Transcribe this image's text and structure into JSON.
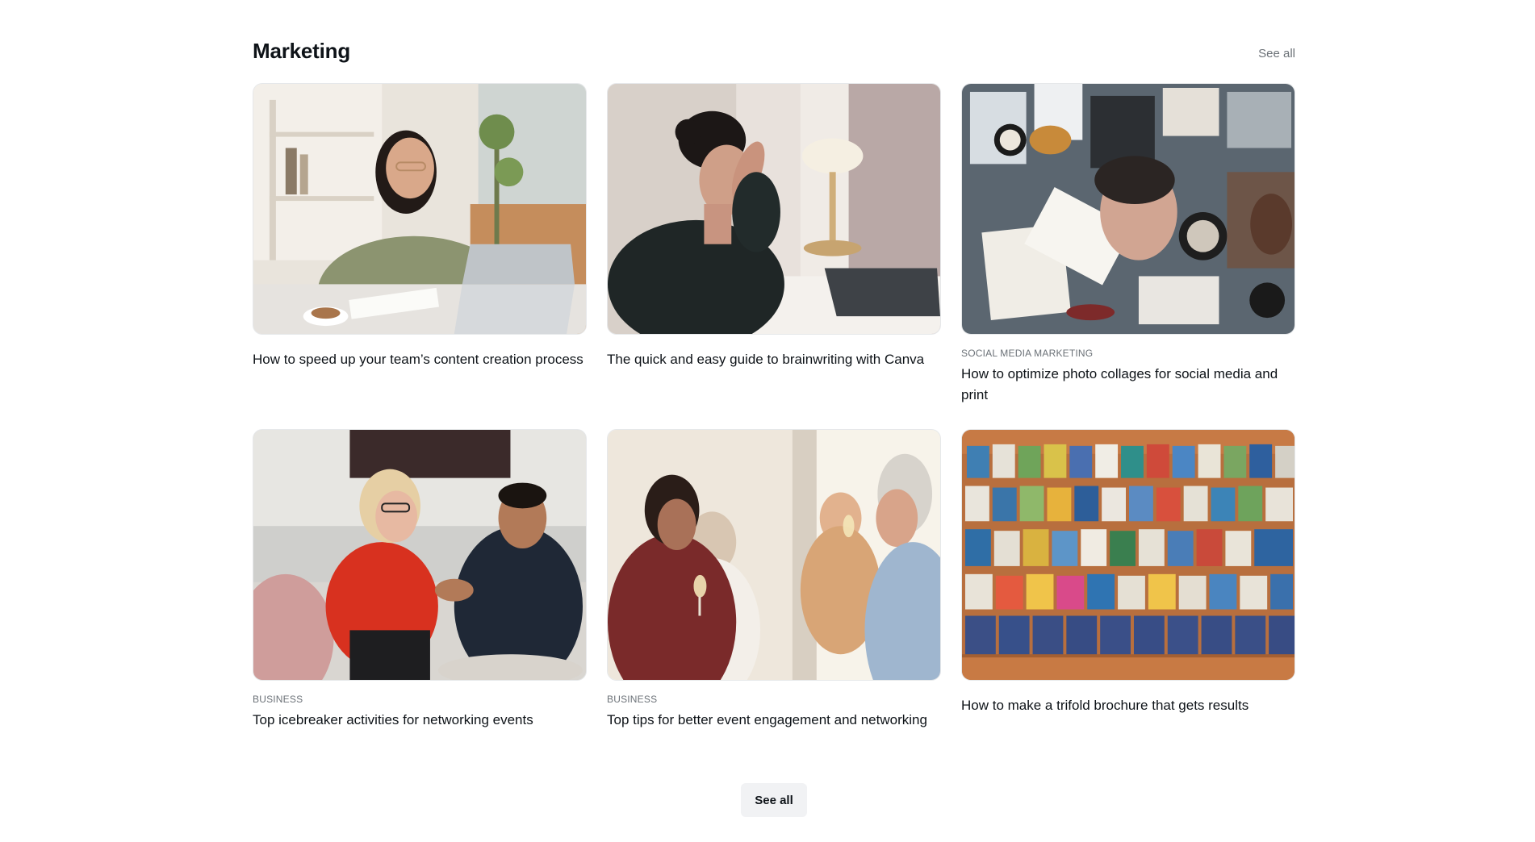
{
  "section": {
    "title": "Marketing",
    "see_all_label": "See all"
  },
  "cards": [
    {
      "category": "",
      "title": "How to speed up your team’s content creation process",
      "image": "woman-with-laptop-illustration"
    },
    {
      "category": "",
      "title": "The quick and easy guide to brainwriting with Canva",
      "image": "woman-thinking-at-desk-illustration"
    },
    {
      "category": "SOCIAL MEDIA MARKETING",
      "title": "How to optimize photo collages for social media and print",
      "image": "photo-collage-illustration"
    },
    {
      "category": "BUSINESS",
      "title": "Top icebreaker activities for networking events",
      "image": "people-talking-illustration"
    },
    {
      "category": "BUSINESS",
      "title": "Top tips for better event engagement and networking",
      "image": "event-networking-illustration"
    },
    {
      "category": "",
      "title": "How to make a trifold brochure that gets results",
      "image": "brochure-rack-illustration"
    }
  ],
  "footer": {
    "see_all_button_label": "See all"
  }
}
